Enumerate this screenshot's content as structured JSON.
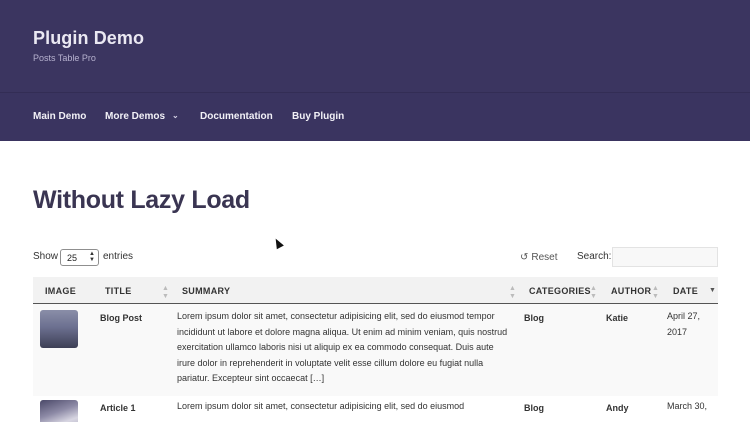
{
  "header": {
    "site_title": "Plugin Demo",
    "tagline": "Posts Table Pro"
  },
  "nav": {
    "items": [
      {
        "label": "Main Demo"
      },
      {
        "label": "More Demos",
        "has_submenu": true
      },
      {
        "label": "Documentation"
      },
      {
        "label": "Buy Plugin"
      }
    ]
  },
  "page": {
    "title": "Without Lazy Load"
  },
  "controls": {
    "show_label": "Show",
    "entries_per_page": "25",
    "entries_label": "entries",
    "reset_label": "Reset",
    "search_label": "Search:"
  },
  "table": {
    "columns": [
      "IMAGE",
      "TITLE",
      "SUMMARY",
      "CATEGORIES",
      "AUTHOR",
      "DATE"
    ],
    "rows": [
      {
        "title": "Blog Post",
        "summary": "Lorem ipsum dolor sit amet, consectetur adipisicing elit, sed do eiusmod tempor incididunt ut labore et dolore magna aliqua. Ut enim ad minim veniam, quis nostrud exercitation ullamco laboris nisi ut aliquip ex ea commodo consequat. Duis aute irure dolor in reprehenderit in voluptate velit esse cillum dolore eu fugiat nulla pariatur. Excepteur sint occaecat […]",
        "category": "Blog",
        "author": "Katie",
        "date": "April 27, 2017"
      },
      {
        "title": "Article 1",
        "summary": "Lorem ipsum dolor sit amet, consectetur adipisicing elit, sed do eiusmod",
        "category": "Blog",
        "author": "Andy",
        "date": "March 30,"
      }
    ]
  },
  "colors": {
    "header_bg": "#3b3560",
    "title_color": "#3a3552"
  }
}
